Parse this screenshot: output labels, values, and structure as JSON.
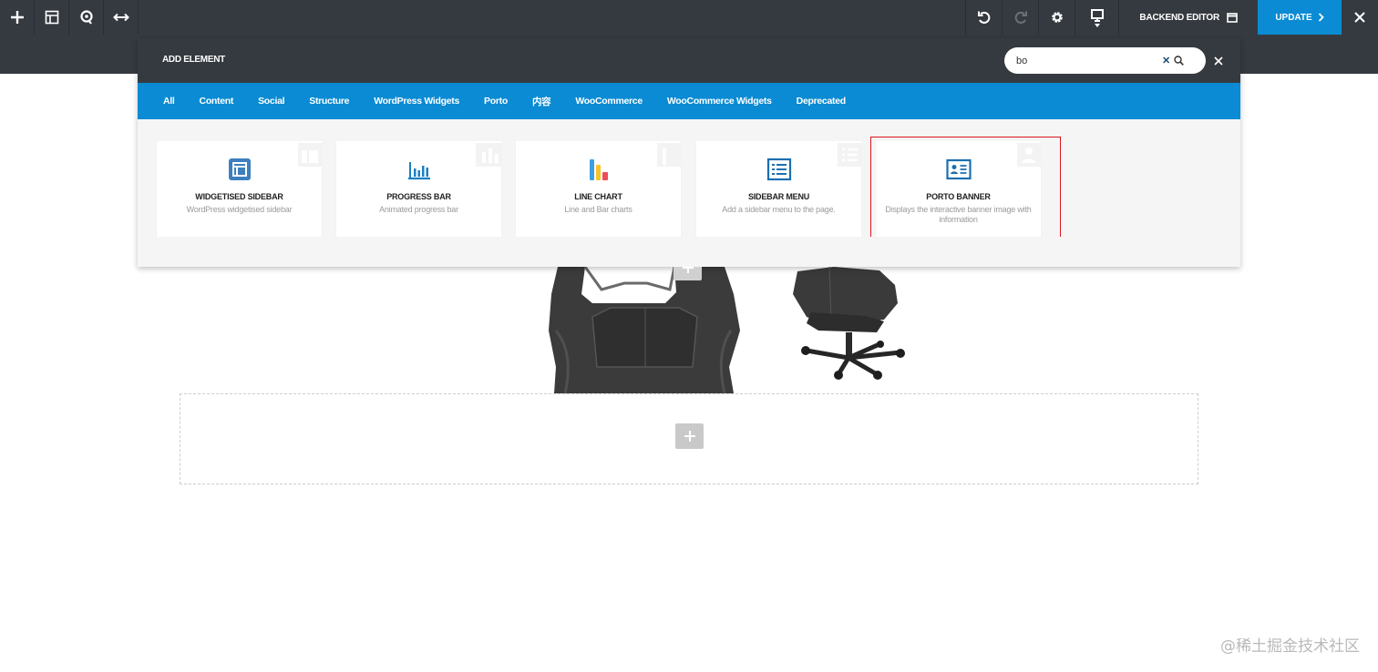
{
  "toolbar": {
    "backend_editor_label": "BACKEND EDITOR",
    "update_label": "UPDATE"
  },
  "modal": {
    "title": "ADD ELEMENT",
    "search_value": "bo",
    "categories": [
      "All",
      "Content",
      "Social",
      "Structure",
      "WordPress Widgets",
      "Porto",
      "内容",
      "WooCommerce",
      "WooCommerce Widgets",
      "Deprecated"
    ],
    "elements": [
      {
        "title": "WIDGETISED SIDEBAR",
        "description": "WordPress widgetised sidebar",
        "icon": "sidebar-widget-icon"
      },
      {
        "title": "PROGRESS BAR",
        "description": "Animated progress bar",
        "icon": "progress-bar-icon"
      },
      {
        "title": "LINE CHART",
        "description": "Line and Bar charts",
        "icon": "line-chart-icon"
      },
      {
        "title": "SIDEBAR MENU",
        "description": "Add a sidebar menu to the page.",
        "icon": "sidebar-menu-icon"
      },
      {
        "title": "PORTO BANNER",
        "description": "Displays the interactive banner image with information",
        "icon": "banner-icon"
      }
    ]
  },
  "colors": {
    "toolbar_bg": "#353a40",
    "accent_blue": "#0a8bd3",
    "highlight_red": "#e0141e"
  },
  "watermark": "@稀土掘金技术社区"
}
